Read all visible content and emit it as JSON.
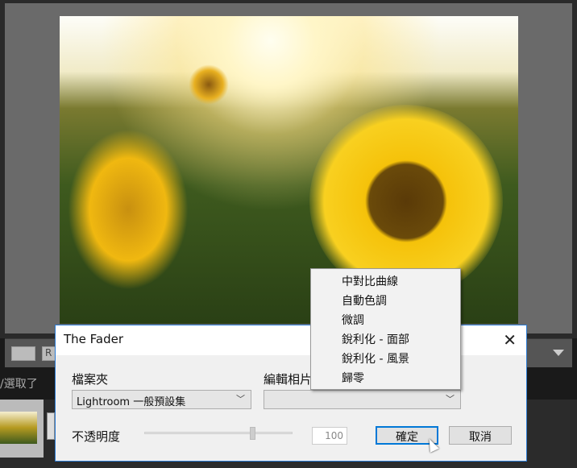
{
  "background": {
    "filmstrip_label": "/選取了",
    "toolbar_button": "R"
  },
  "dialog": {
    "title": "The Fader",
    "folder_label": "檔案夾",
    "folder_value": "Lightroom 一般預設集",
    "preset_label": "編輯相片",
    "preset_value": "",
    "opacity_label": "不透明度",
    "opacity_value": "100",
    "opacity_percent": 100,
    "ok_label": "確定",
    "cancel_label": "取消"
  },
  "menu": {
    "items": [
      "中對比曲線",
      "自動色調",
      "微調",
      "銳利化 - 面部",
      "銳利化 - 風景",
      "歸零"
    ]
  }
}
